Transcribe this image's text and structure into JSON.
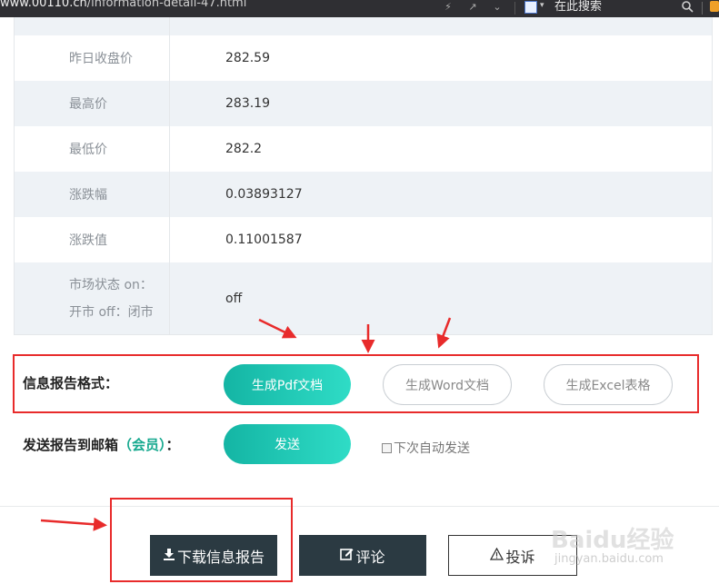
{
  "browser": {
    "url_host": "www.00110.cn",
    "url_path": "/information-detail-47.html",
    "search_placeholder": "在此搜索"
  },
  "table": {
    "rows": [
      {
        "label": "昨日收盘价",
        "value": "282.59"
      },
      {
        "label": "最高价",
        "value": "283.19"
      },
      {
        "label": "最低价",
        "value": "282.2"
      },
      {
        "label": "涨跌幅",
        "value": "0.03893127"
      },
      {
        "label": "涨跌值",
        "value": "0.11001587"
      }
    ],
    "status_row": {
      "label_line1": "市场状态 on：",
      "label_line2": "开市 off：闭市",
      "value": "off"
    }
  },
  "report": {
    "format_label": "信息报告格式：",
    "pdf_button": "生成Pdf文档",
    "word_button": "生成Word文档",
    "excel_button": "生成Excel表格",
    "email_label_prefix": "发送报告到邮箱",
    "email_label_member": "（会员）",
    "email_label_suffix": "：",
    "send_button": "发送",
    "auto_send_label": "下次自动发送"
  },
  "actions": {
    "download_label": "下载信息报告",
    "comment_label": "评论",
    "report_label": "投诉"
  },
  "watermark": {
    "brand": "Baidu经验",
    "domain": "jingyan.baidu.com"
  },
  "colors": {
    "accent_teal": "#14b5a4",
    "annotation_red": "#e82b2b",
    "dark_button": "#2b3a42"
  }
}
